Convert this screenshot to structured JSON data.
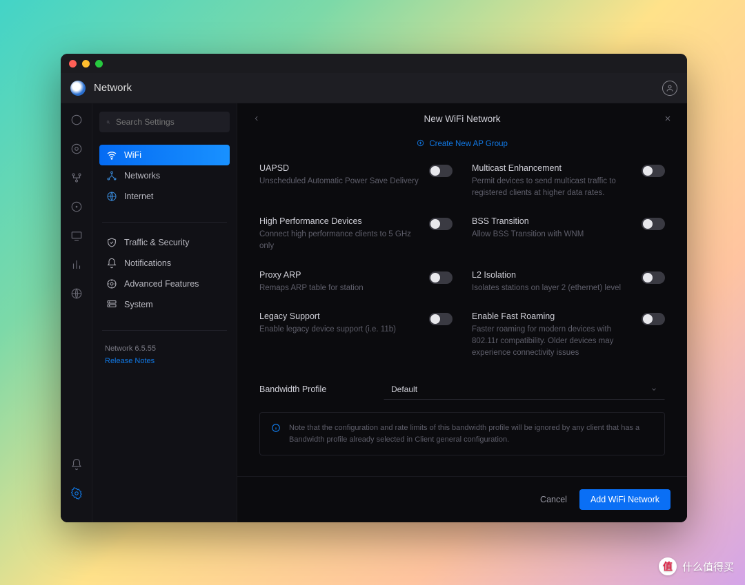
{
  "header": {
    "title": "Network"
  },
  "search": {
    "placeholder": "Search Settings"
  },
  "sidebar": {
    "group1": [
      {
        "label": "WiFi"
      },
      {
        "label": "Networks"
      },
      {
        "label": "Internet"
      }
    ],
    "group2": [
      {
        "label": "Traffic & Security"
      },
      {
        "label": "Notifications"
      },
      {
        "label": "Advanced Features"
      },
      {
        "label": "System"
      }
    ],
    "version": "Network 6.5.55",
    "release_notes": "Release Notes"
  },
  "panel": {
    "title": "New WiFi Network",
    "create_ap": "Create New AP Group"
  },
  "settings": {
    "uapsd": {
      "label": "UAPSD",
      "desc": "Unscheduled Automatic Power Save Delivery"
    },
    "multicast": {
      "label": "Multicast Enhancement",
      "desc": "Permit devices to send multicast traffic to registered clients at higher data rates."
    },
    "high_perf": {
      "label": "High Performance Devices",
      "desc": "Connect high performance clients to 5 GHz only"
    },
    "bss": {
      "label": "BSS Transition",
      "desc": "Allow BSS Transition with WNM"
    },
    "proxy_arp": {
      "label": "Proxy ARP",
      "desc": "Remaps ARP table for station"
    },
    "l2": {
      "label": "L2 Isolation",
      "desc": "Isolates stations on layer 2 (ethernet) level"
    },
    "legacy": {
      "label": "Legacy Support",
      "desc": "Enable legacy device support (i.e. 11b)"
    },
    "fast_roam": {
      "label": "Enable Fast Roaming",
      "desc": "Faster roaming for modern devices with 802.11r compatibility. Older devices may experience connectivity issues"
    }
  },
  "bandwidth": {
    "label": "Bandwidth Profile",
    "value": "Default",
    "note": "Note that the configuration and rate limits of this bandwidth profile will be ignored by any client that has a Bandwidth profile already selected in Client general configuration."
  },
  "footer": {
    "cancel": "Cancel",
    "submit": "Add WiFi Network"
  },
  "watermark": "什么值得买"
}
